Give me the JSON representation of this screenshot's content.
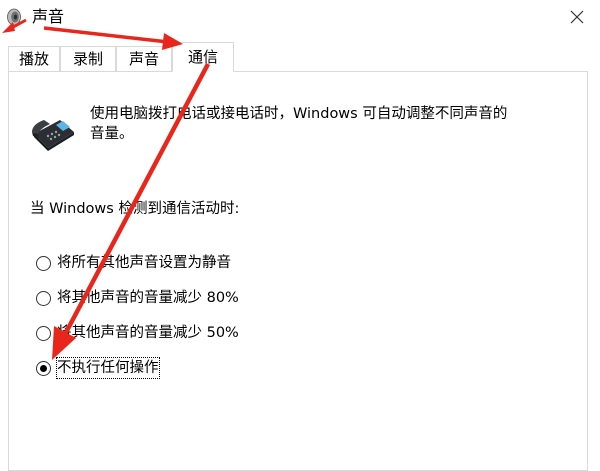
{
  "window": {
    "title": "声音",
    "close_symbol": "×"
  },
  "tabs": [
    {
      "label": "播放",
      "active": false
    },
    {
      "label": "录制",
      "active": false
    },
    {
      "label": "声音",
      "active": false
    },
    {
      "label": "通信",
      "active": true
    }
  ],
  "panel": {
    "icon": "telephone-icon",
    "description": "使用电脑拨打电话或接电话时，Windows 可自动调整不同声音的音量。",
    "intro": "当 Windows 检测到通信活动时:",
    "options": [
      {
        "label": "将所有其他声音设置为静音",
        "checked": false
      },
      {
        "label": "将其他声音的音量减少 80%",
        "checked": false
      },
      {
        "label": "将其他声音的音量减少 50%",
        "checked": false
      },
      {
        "label": "不执行任何操作",
        "checked": true
      }
    ]
  },
  "colors": {
    "annotation_arrow": "#e8261c",
    "border": "#d9d9d9"
  }
}
